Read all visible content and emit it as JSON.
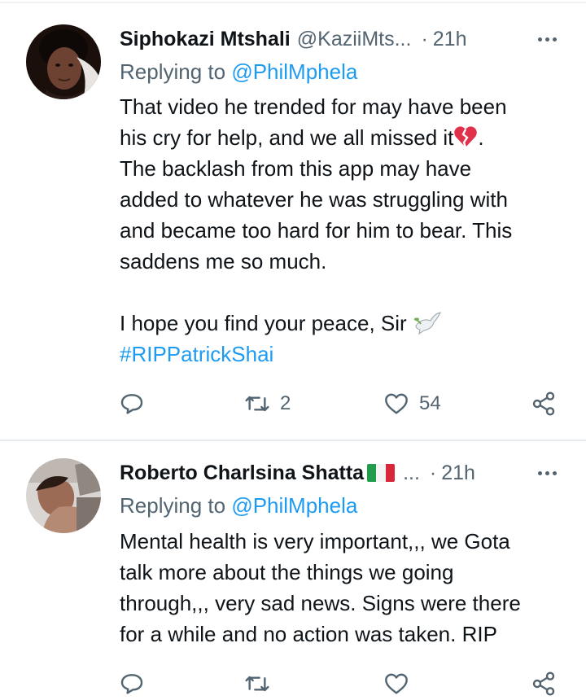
{
  "tweets": [
    {
      "author_name": "Siphokazi Mtshali",
      "author_handle": "@KaziiMts...",
      "separator": "·",
      "time": "21h",
      "replying_prefix": "Replying to ",
      "replying_to": "@PhilMphela",
      "body_lines": [
        "That video he trended for may have been",
        "his cry for help, and we all missed it",
        "The backlash from this app may have",
        "added to whatever he was struggling with",
        "and became too hard for him to bear. This",
        "saddens me so much."
      ],
      "body_line2_suffix": ".",
      "body_line2_emoji": "broken-heart-emoji",
      "closing_line": "I hope you find your peace, Sir",
      "closing_emoji": "dove-emoji",
      "hashtag": "#RIPPatrickShai",
      "reply_count": "",
      "retweet_count": "2",
      "like_count": "54"
    },
    {
      "author_name": "Roberto Charlsina Shatta",
      "author_name_flag": "italy-flag",
      "author_handle": "...",
      "separator": "·",
      "time": "21h",
      "replying_prefix": "Replying to ",
      "replying_to": "@PhilMphela",
      "body_lines": [
        "Mental health is very important,,, we Gota",
        "talk more about the things we going",
        "through,,, very sad news. Signs were there",
        "for a while and no action was taken. RIP"
      ]
    }
  ],
  "colors": {
    "text": "#0f1419",
    "secondary": "#536471",
    "link": "#1d9bf0",
    "divider": "#e6ecf0"
  },
  "icons": [
    "reply-icon",
    "retweet-icon",
    "like-icon",
    "share-icon",
    "more-icon"
  ]
}
